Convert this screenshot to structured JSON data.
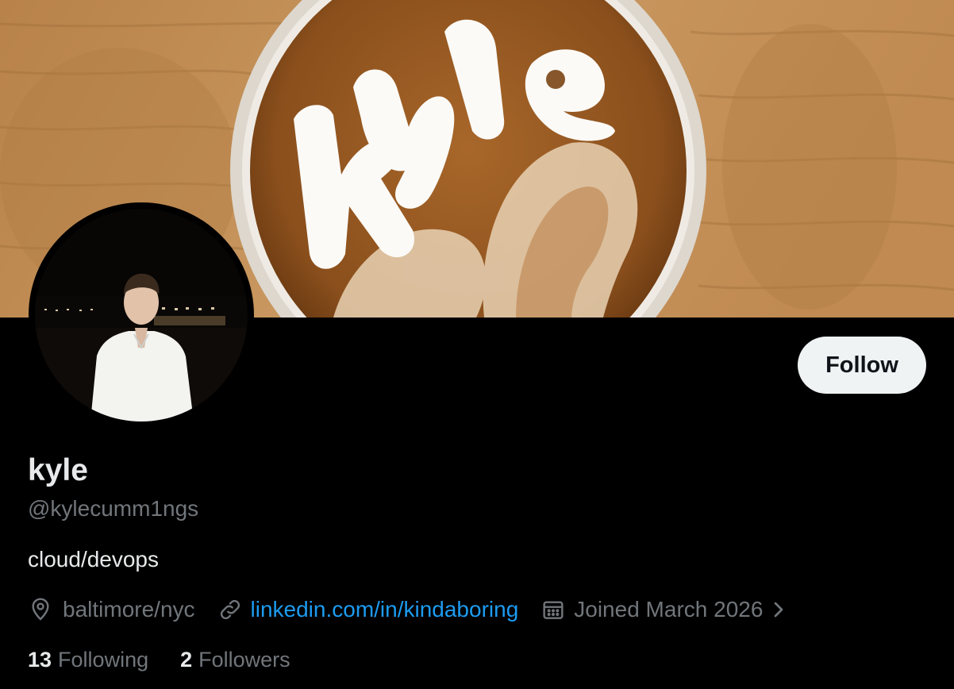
{
  "profile": {
    "display_name": "kyle",
    "handle": "@kylecumm1ngs",
    "bio": "cloud/devops",
    "follow_label": "Follow"
  },
  "meta": {
    "location": "baltimore/nyc",
    "link_text": "linkedin.com/in/kindaboring",
    "joined": "Joined March 2026"
  },
  "counts": {
    "following_count": "13",
    "following_label": "Following",
    "followers_count": "2",
    "followers_label": "Followers"
  },
  "colors": {
    "background": "#000000",
    "follow_button_bg": "#eff3f4",
    "link": "#1d9bf0",
    "secondary_text": "#71767b",
    "primary_text": "#e7e9ea"
  },
  "icons": {
    "location": "map-pin-icon",
    "link": "link-icon",
    "joined": "calendar-icon",
    "joined_more": "chevron-right-icon"
  }
}
